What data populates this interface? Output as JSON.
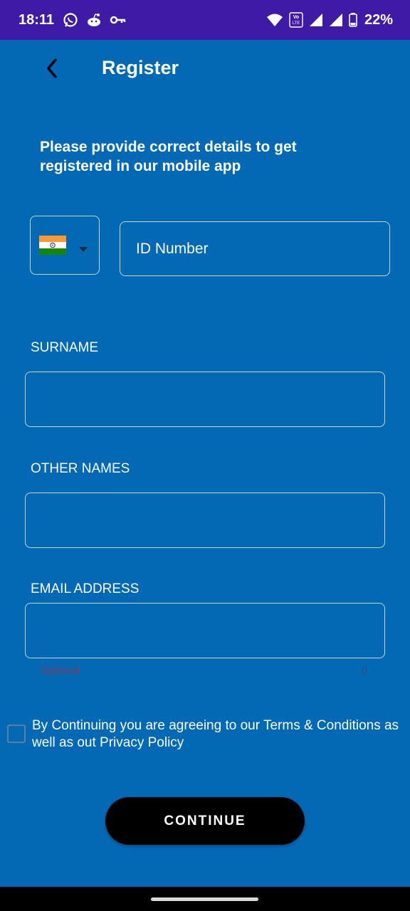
{
  "status_bar": {
    "time": "18:11",
    "battery": "22%",
    "icons": [
      "whatsapp-icon",
      "reddit-icon",
      "vpn-key-icon",
      "wifi-icon",
      "volte-icon",
      "signal-icon",
      "signal-icon",
      "battery-icon"
    ],
    "volte_text": "Vo LTE"
  },
  "header": {
    "back_icon": "chevron-left-icon",
    "title": "Register"
  },
  "intro": {
    "text": "Please provide correct details to get registered in our mobile app"
  },
  "country_picker": {
    "flag": "india-flag-icon",
    "caret": "caret-down-icon"
  },
  "id_field": {
    "placeholder": "ID Number",
    "value": ""
  },
  "fields": {
    "surname": {
      "label": "SURNAME",
      "value": ""
    },
    "other_names": {
      "label": "OTHER NAMES",
      "value": ""
    },
    "email": {
      "label": "EMAIL ADDRESS",
      "value": "",
      "helper": "Optional",
      "counter": "0"
    }
  },
  "terms": {
    "checked": false,
    "text": "By Continuing you are agreeing to our Terms & Conditions as well as out Privacy Policy"
  },
  "actions": {
    "continue_label": "CONTINUE"
  },
  "colors": {
    "background": "#0369b5",
    "status_bar": "#3e1aa6",
    "button": "#000000",
    "field_border": "#c5d6e6"
  }
}
